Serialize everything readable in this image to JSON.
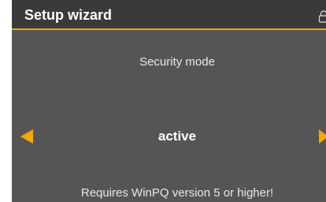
{
  "header": {
    "title": "Setup wizard",
    "lock_icon": "lock-icon"
  },
  "setting": {
    "label": "Security mode",
    "value": "active",
    "prev_icon": "arrow-left-icon",
    "next_icon": "arrow-right-icon"
  },
  "footer": {
    "note": "Requires WinPQ version 5 or higher!"
  },
  "colors": {
    "background": "#555555",
    "title_bar": "#3a3a3a",
    "accent": "#f5a800",
    "text": "#ffffff"
  }
}
